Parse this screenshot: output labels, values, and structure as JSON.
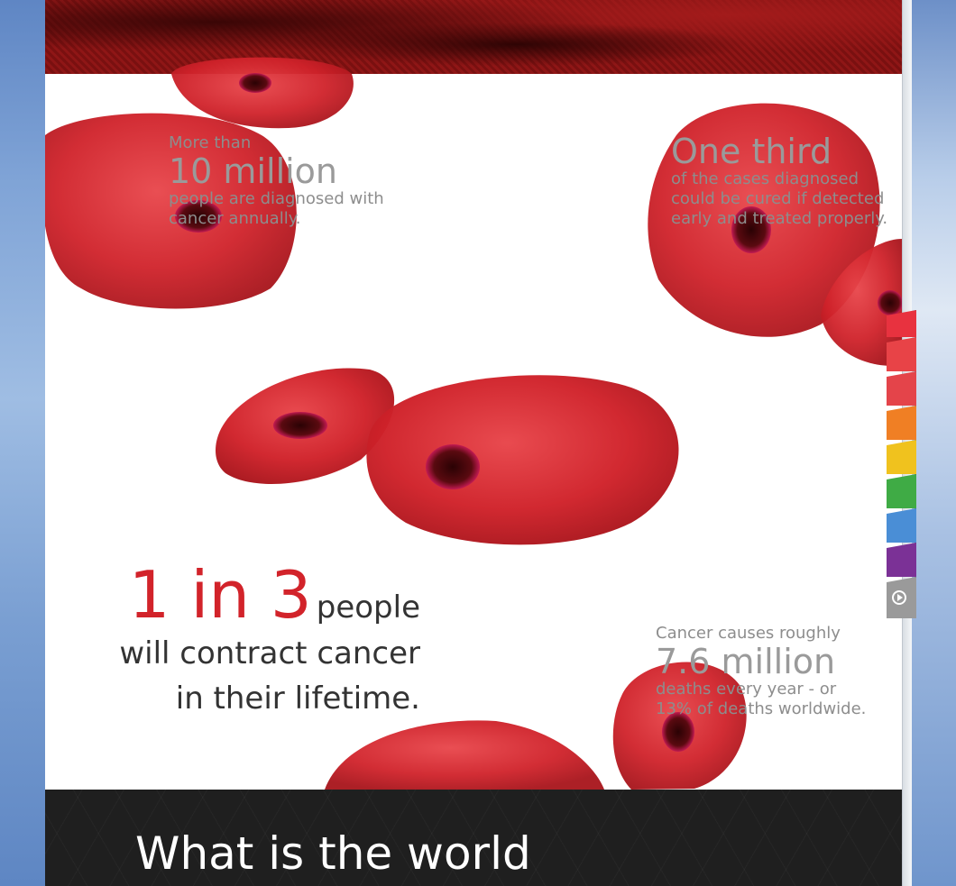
{
  "colors": {
    "accent_red": "#d2232a",
    "stat_gray": "#8d8d8d",
    "dark_band": "#1f1f1f"
  },
  "stats": {
    "top_left": {
      "prefix": "More than",
      "big": "10 million",
      "line1": "people are diagnosed with",
      "line2": "cancer annually."
    },
    "top_right": {
      "big": "One third",
      "line1": "of the cases diagnosed",
      "line2": "could be cured if detected",
      "line3": "early and treated properly."
    },
    "bottom_right": {
      "prefix": "Cancer causes roughly",
      "big": "7.6 million",
      "line1": "deaths every year - or",
      "line2": "13% of deaths worldwide."
    }
  },
  "hero_stat": {
    "number": "1 in 3",
    "word": "people",
    "line1": "will contract cancer",
    "line2": "in their lifetime."
  },
  "section": {
    "heading": "What is the world"
  },
  "nav_tabs": [
    {
      "color": "#e8323f",
      "icon": ""
    },
    {
      "color": "#e84347",
      "icon": ""
    },
    {
      "color": "#e4444a",
      "icon": ""
    },
    {
      "color": "#f07f24",
      "icon": ""
    },
    {
      "color": "#f0c21e",
      "icon": ""
    },
    {
      "color": "#3fab45",
      "icon": ""
    },
    {
      "color": "#4a8ed6",
      "icon": ""
    },
    {
      "color": "#7b3196",
      "icon": ""
    },
    {
      "color": "#9a9a9a",
      "icon": "play-icon"
    }
  ]
}
